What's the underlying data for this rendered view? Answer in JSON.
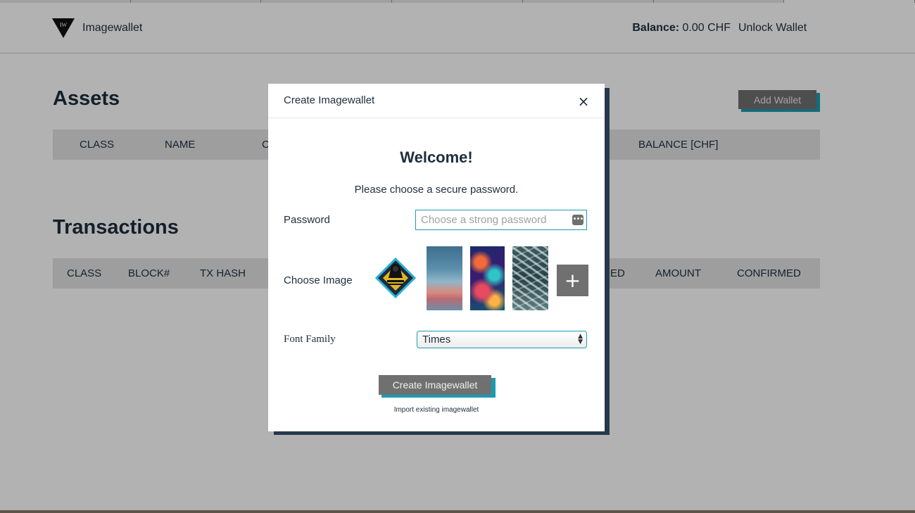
{
  "header": {
    "brand": "Imagewallet",
    "logo_text": "IW",
    "balance_label": "Balance:",
    "balance_value": "0.00 CHF",
    "unlock_wallet": "Unlock Wallet"
  },
  "assets": {
    "title": "Assets",
    "add_wallet": "Add Wallet",
    "columns": [
      "CLASS",
      "NAME",
      "C",
      "BALANCE [CHF]"
    ]
  },
  "transactions": {
    "title": "Transactions",
    "columns": [
      "CLASS",
      "BLOCK#",
      "TX HASH",
      "ED",
      "AMOUNT",
      "CONFIRMED"
    ]
  },
  "modal": {
    "title": "Create Imagewallet",
    "close": "×",
    "welcome": "Welcome!",
    "subtitle": "Please choose a secure password.",
    "password_label": "Password",
    "password_placeholder": "Choose a strong password",
    "password_icon": "•••",
    "choose_image_label": "Choose Image",
    "add_image": "+",
    "font_family_label": "Font Family",
    "font_family_value": "Times",
    "create_button": "Create Imagewallet",
    "import_link": "Import existing imagewallet"
  },
  "colors": {
    "accent": "#1a9bb0",
    "text": "#1e2d3e",
    "button": "#707070",
    "modal_shadow": "#27384c"
  }
}
